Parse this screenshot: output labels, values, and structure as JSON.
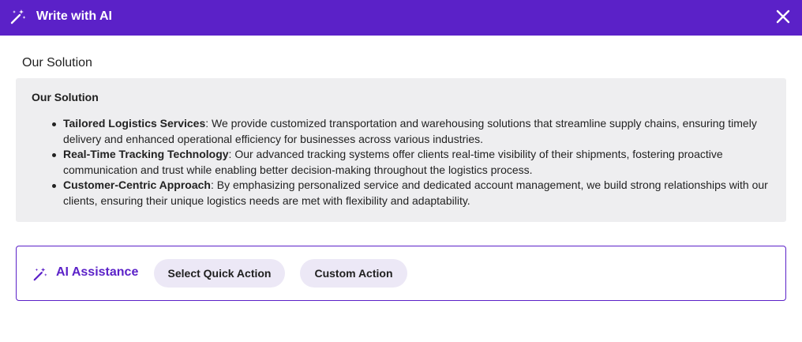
{
  "header": {
    "title": "Write with AI",
    "wand_icon": "magic-wand-icon",
    "close_icon": "close-icon",
    "background": "#5b21c8"
  },
  "section": {
    "heading": "Our Solution"
  },
  "content": {
    "title": "Our Solution",
    "bullets": [
      {
        "term": "Tailored Logistics Services",
        "text": ": We provide customized transportation and warehousing solutions that streamline supply chains, ensuring timely delivery and enhanced operational efficiency for businesses across various industries."
      },
      {
        "term": "Real-Time Tracking Technology",
        "text": ": Our advanced tracking systems offer clients real-time visibility of their shipments, fostering proactive communication and trust while enabling better decision-making throughout the logistics process."
      },
      {
        "term": "Customer-Centric Approach",
        "text": ": By emphasizing personalized service and dedicated account management, we build strong relationships with our clients, ensuring their unique logistics needs are met with flexibility and adaptability."
      }
    ]
  },
  "ai_assistance": {
    "label": "AI Assistance",
    "icon": "magic-wand-icon",
    "quick_action_label": "Select Quick Action",
    "custom_action_label": "Custom Action",
    "accent": "#5b21c8",
    "pill_background": "#ece8f6"
  }
}
